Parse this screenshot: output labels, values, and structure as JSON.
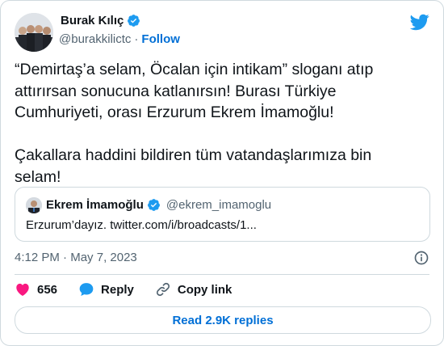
{
  "author": {
    "name": "Burak Kılıç",
    "handle": "@burakkilictc",
    "follow_label": "Follow"
  },
  "tweet": {
    "text": "“Demirtaş’a selam, Öcalan için intikam” sloganı atıp\nattırırsan sonucuna katlanırsın! Burası Türkiye\nCumhuriyeti, orası Erzurum Ekrem İmamoğlu!\n\nÇakallara haddini bildiren tüm vatandaşlarımıza bin\nselam!"
  },
  "quote": {
    "name": "Ekrem İmamoğlu",
    "handle": "@ekrem_imamoglu",
    "text": "Erzurum’dayız. twitter.com/i/broadcasts/1..."
  },
  "timestamp": {
    "time": "4:12 PM",
    "separator": "·",
    "date": "May 7, 2023"
  },
  "actions": {
    "likes": "656",
    "reply_label": "Reply",
    "copy_link_label": "Copy link"
  },
  "read_replies_label": "Read 2.9K replies",
  "colors": {
    "link": "#006fd6",
    "verified": "#1d9bf0",
    "heart": "#f91880",
    "muted": "#536471",
    "border": "#cfd9de"
  },
  "icons": [
    "verified-icon",
    "twitter-bird-icon",
    "info-icon",
    "heart-icon",
    "reply-bubble-icon",
    "link-icon"
  ]
}
